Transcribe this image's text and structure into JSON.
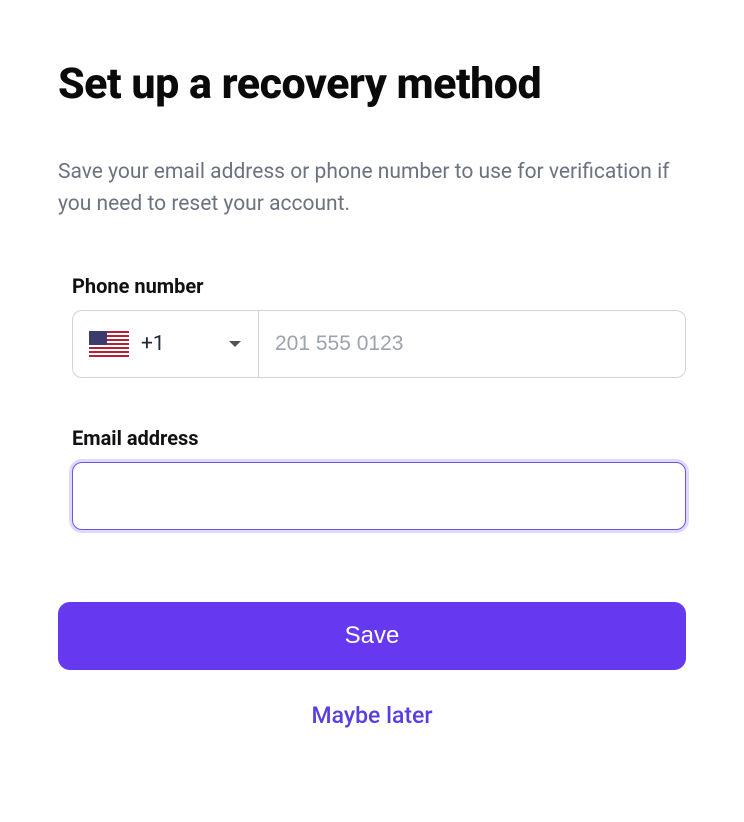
{
  "heading": "Set up a recovery method",
  "subtitle": "Save your email address or phone number to use for verification if you need to reset your account.",
  "phone": {
    "label": "Phone number",
    "country_code": "+1",
    "country_flag": "us",
    "placeholder": "201 555 0123",
    "value": ""
  },
  "email": {
    "label": "Email address",
    "value": ""
  },
  "actions": {
    "save": "Save",
    "later": "Maybe later"
  },
  "colors": {
    "accent": "#6638ef",
    "focus_ring": "#b9a8f8",
    "text_muted": "#6b7280"
  }
}
